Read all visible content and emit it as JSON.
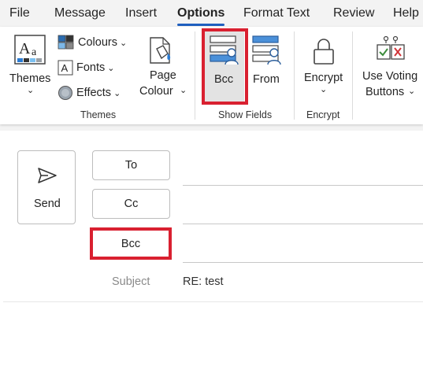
{
  "menu": {
    "file": "File",
    "message": "Message",
    "insert": "Insert",
    "options": "Options",
    "format_text": "Format Text",
    "review": "Review",
    "help": "Help"
  },
  "ribbon": {
    "themes": {
      "label": "Themes",
      "chevron": "⌄"
    },
    "colours": {
      "label": "Colours",
      "chevron": "⌄"
    },
    "fonts": {
      "label": "Fonts",
      "chevron": "⌄"
    },
    "effects": {
      "label": "Effects",
      "chevron": "⌄"
    },
    "page_colour": {
      "label_line1": "Page",
      "label_line2": "Colour",
      "chevron": "⌄"
    },
    "themes_group": "Themes",
    "bcc": {
      "label": "Bcc"
    },
    "from": {
      "label": "From"
    },
    "show_fields_group": "Show Fields",
    "encrypt": {
      "label": "Encrypt",
      "chevron": "⌄"
    },
    "encrypt_group": "Encrypt",
    "voting": {
      "label_line1": "Use Voting",
      "label_line2": "Buttons",
      "chevron": "⌄"
    }
  },
  "compose": {
    "send": "Send",
    "to": "To",
    "cc": "Cc",
    "bcc": "Bcc",
    "subject_label": "Subject",
    "subject_value": "RE: test"
  },
  "colors": {
    "accent": "#1f5fbf",
    "highlight": "#d92030"
  }
}
